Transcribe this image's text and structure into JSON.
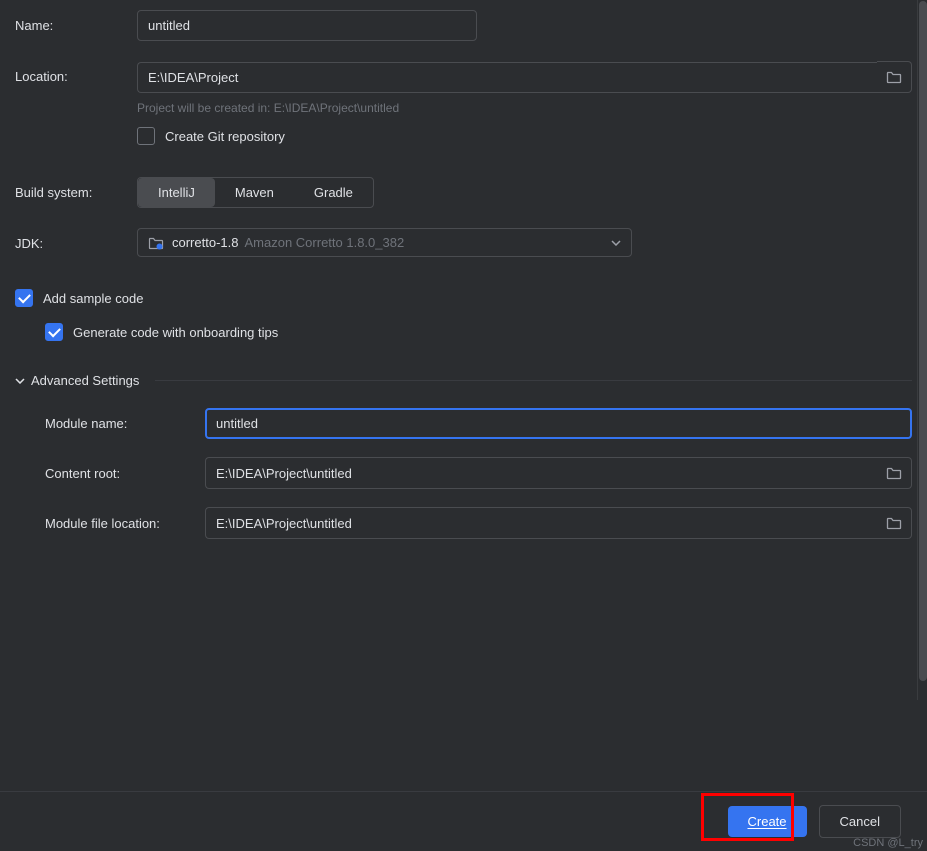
{
  "name": {
    "label": "Name:",
    "value": "untitled"
  },
  "location": {
    "label": "Location:",
    "value": "E:\\IDEA\\Project",
    "hint": "Project will be created in: E:\\IDEA\\Project\\untitled",
    "git_label": "Create Git repository"
  },
  "build_system": {
    "label": "Build system:",
    "options": [
      "IntelliJ",
      "Maven",
      "Gradle"
    ],
    "selected": 0
  },
  "jdk": {
    "label": "JDK:",
    "version": "corretto-1.8",
    "detail": "Amazon Corretto 1.8.0_382"
  },
  "sample_code": {
    "label": "Add sample code"
  },
  "onboarding": {
    "label": "Generate code with onboarding tips"
  },
  "advanced": {
    "title": "Advanced Settings",
    "module_name": {
      "label": "Module name:",
      "value": "untitled"
    },
    "content_root": {
      "label": "Content root:",
      "value": "E:\\IDEA\\Project\\untitled"
    },
    "module_file": {
      "label": "Module file location:",
      "value": "E:\\IDEA\\Project\\untitled"
    }
  },
  "footer": {
    "create": "Create",
    "cancel": "Cancel"
  },
  "watermark": "CSDN @L_try"
}
